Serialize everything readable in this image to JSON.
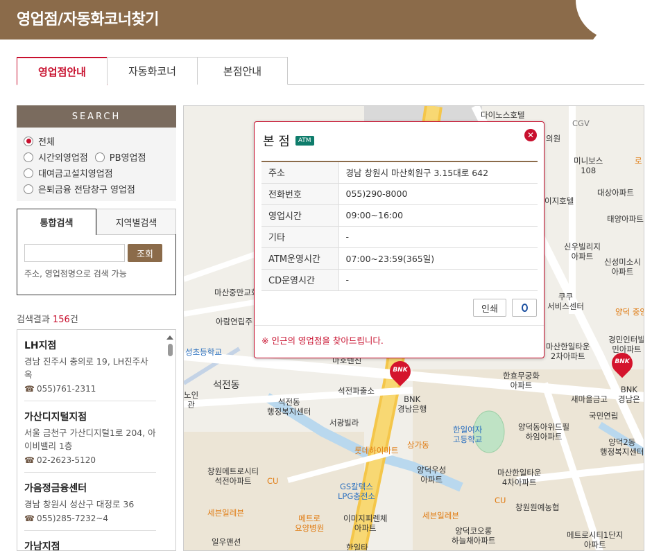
{
  "header": {
    "title": "영업점/자동화코너찾기"
  },
  "tabs": [
    {
      "label": "영업점안내"
    },
    {
      "label": "자동화코너"
    },
    {
      "label": "본점안내"
    }
  ],
  "search": {
    "heading": "SEARCH",
    "radios": [
      "전체",
      "시간외영업점",
      "PB영업점",
      "대여금고설치영업점",
      "은퇴금융 전담창구 영업점"
    ],
    "subtabs": [
      "통합검색",
      "지역별검색"
    ],
    "input_value": "",
    "button": "조회",
    "hint": "주소, 영업점명으로 검색 가능"
  },
  "results": {
    "prefix": "검색결과 ",
    "count": "156",
    "suffix": "건",
    "items": [
      {
        "name": "LH지점",
        "addr": "경남 진주시 충의로 19, LH진주사옥",
        "tel": "055)761-2311"
      },
      {
        "name": "가산디지털지점",
        "addr": "서울 금천구 가산디지털1로 204, 아이비밸리 1층",
        "tel": "02-2623-5120"
      },
      {
        "name": "가음정금융센터",
        "addr": "경남 창원시 성산구 대정로 36",
        "tel": "055)285-7232~4"
      },
      {
        "name": "가남지점",
        "addr": "",
        "tel": ""
      }
    ]
  },
  "popup": {
    "title": "본 점",
    "badge": "ATM",
    "rows": [
      {
        "k": "주소",
        "v": "경남 창원시 마산회원구 3.15대로 642"
      },
      {
        "k": "전화번호",
        "v": "055)290-8000"
      },
      {
        "k": "영업시간",
        "v": "09:00~16:00"
      },
      {
        "k": "기타",
        "v": "-"
      },
      {
        "k": "ATM운영시간",
        "v": "07:00~23:59(365일)"
      },
      {
        "k": "CD운영시간",
        "v": "-"
      }
    ],
    "print_label": "인쇄",
    "footer": "※ 인근의 영업점을 찾아드립니다."
  },
  "map": {
    "labels": [
      {
        "t": "다이노스호텔",
        "c": ""
      },
      {
        "t": "CGV",
        "c": "gray"
      },
      {
        "t": "의원",
        "c": ""
      },
      {
        "t": "미니보스\n108",
        "c": ""
      },
      {
        "t": "로",
        "c": "orange"
      },
      {
        "t": "대상아파트",
        "c": ""
      },
      {
        "t": "이지호텔",
        "c": ""
      },
      {
        "t": "태양아파트",
        "c": ""
      },
      {
        "t": "신우빌리지\n아파트",
        "c": ""
      },
      {
        "t": "신성미소시\n아파트",
        "c": ""
      },
      {
        "t": "마산중만교회",
        "c": ""
      },
      {
        "t": "쿠쿠\n서비스센터",
        "c": ""
      },
      {
        "t": "양덕 중앙",
        "c": "orange"
      },
      {
        "t": "아람연립주",
        "c": ""
      },
      {
        "t": "성초등학교",
        "c": "blue"
      },
      {
        "t": "마산한일타운\n2차아파트",
        "c": ""
      },
      {
        "t": "경민인터빌\n민아파트",
        "c": ""
      },
      {
        "t": "마호텐친",
        "c": ""
      },
      {
        "t": "한효무궁화\n아파트",
        "c": ""
      },
      {
        "t": "석전동",
        "c": ""
      },
      {
        "t": "석전파출소",
        "c": ""
      },
      {
        "t": "BNK\n경남은행",
        "c": ""
      },
      {
        "t": "새마을금고",
        "c": ""
      },
      {
        "t": "BNK\n경남은",
        "c": ""
      },
      {
        "t": "노인\n관",
        "c": ""
      },
      {
        "t": "석전동\n행정복지센터",
        "c": ""
      },
      {
        "t": "국민연립",
        "c": ""
      },
      {
        "t": "서광빌라",
        "c": ""
      },
      {
        "t": "한일여자\n고등학교",
        "c": "blue"
      },
      {
        "t": "양덕동아위드필\n하임아파트",
        "c": ""
      },
      {
        "t": "상가동",
        "c": "orange"
      },
      {
        "t": "롯데하이마트",
        "c": "orange"
      },
      {
        "t": "양덕2동\n행정복지센터",
        "c": ""
      },
      {
        "t": "창원메트로시티\n석전아파트",
        "c": ""
      },
      {
        "t": "CU",
        "c": "orange"
      },
      {
        "t": "양덕우성\n아파트",
        "c": ""
      },
      {
        "t": "마산한일타운\n4차아파트",
        "c": ""
      },
      {
        "t": "GS칼텍스\nLPG충전소",
        "c": "blue"
      },
      {
        "t": "CU",
        "c": "orange"
      },
      {
        "t": "창원원예농협",
        "c": ""
      },
      {
        "t": "세븐일레븐",
        "c": "orange"
      },
      {
        "t": "메트로\n요양병원",
        "c": "orange"
      },
      {
        "t": "이미지피렌체\n아파트",
        "c": ""
      },
      {
        "t": "세븐일레븐",
        "c": "orange"
      },
      {
        "t": "양덕코오롱\n하늘채아파트",
        "c": ""
      },
      {
        "t": "메트로시티1단지\n아파트",
        "c": ""
      },
      {
        "t": "일우맨션",
        "c": ""
      },
      {
        "t": "한일타",
        "c": ""
      }
    ],
    "marker_text": "BNK"
  }
}
